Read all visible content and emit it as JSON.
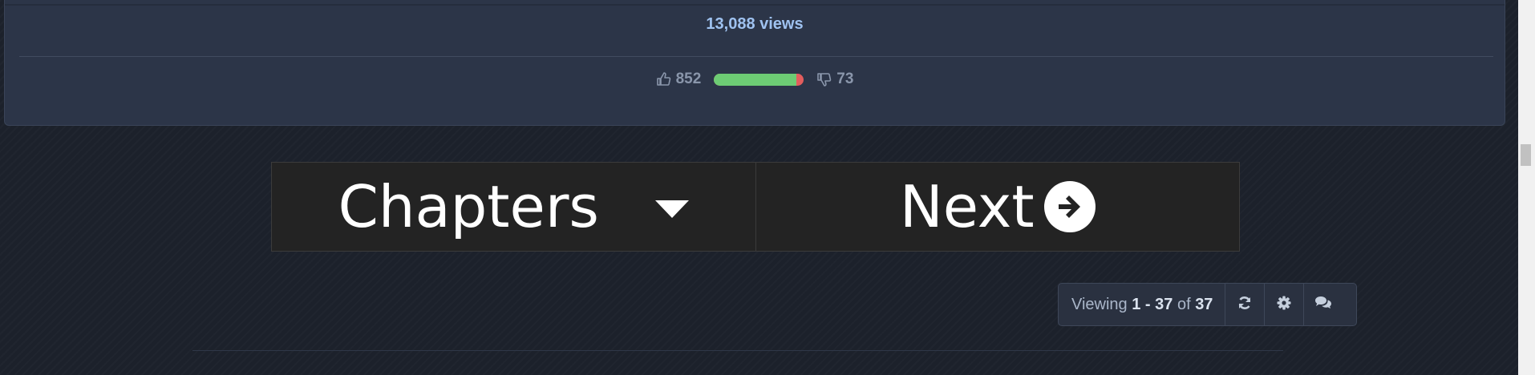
{
  "story_card": {
    "views": "13,088 views",
    "likes": "852",
    "dislikes": "73",
    "like_ratio": 0.921,
    "colors": {
      "like": "#6dcc74",
      "dislike": "#e35d5d",
      "views": "#9fc2f0"
    }
  },
  "nav": {
    "chapters_label": "Chapters",
    "next_label": "Next"
  },
  "viewing": {
    "prefix": "Viewing ",
    "start": "1",
    "dash": " - ",
    "end": "37",
    "of": " of ",
    "total": "37"
  },
  "icons": {
    "like": "thumbs-up-icon",
    "dislike": "thumbs-down-icon",
    "chapters_dropdown": "caret-down-icon",
    "next": "arrow-circle-right-icon",
    "refresh": "refresh-icon",
    "settings": "gear-icon",
    "comments": "comments-icon"
  }
}
